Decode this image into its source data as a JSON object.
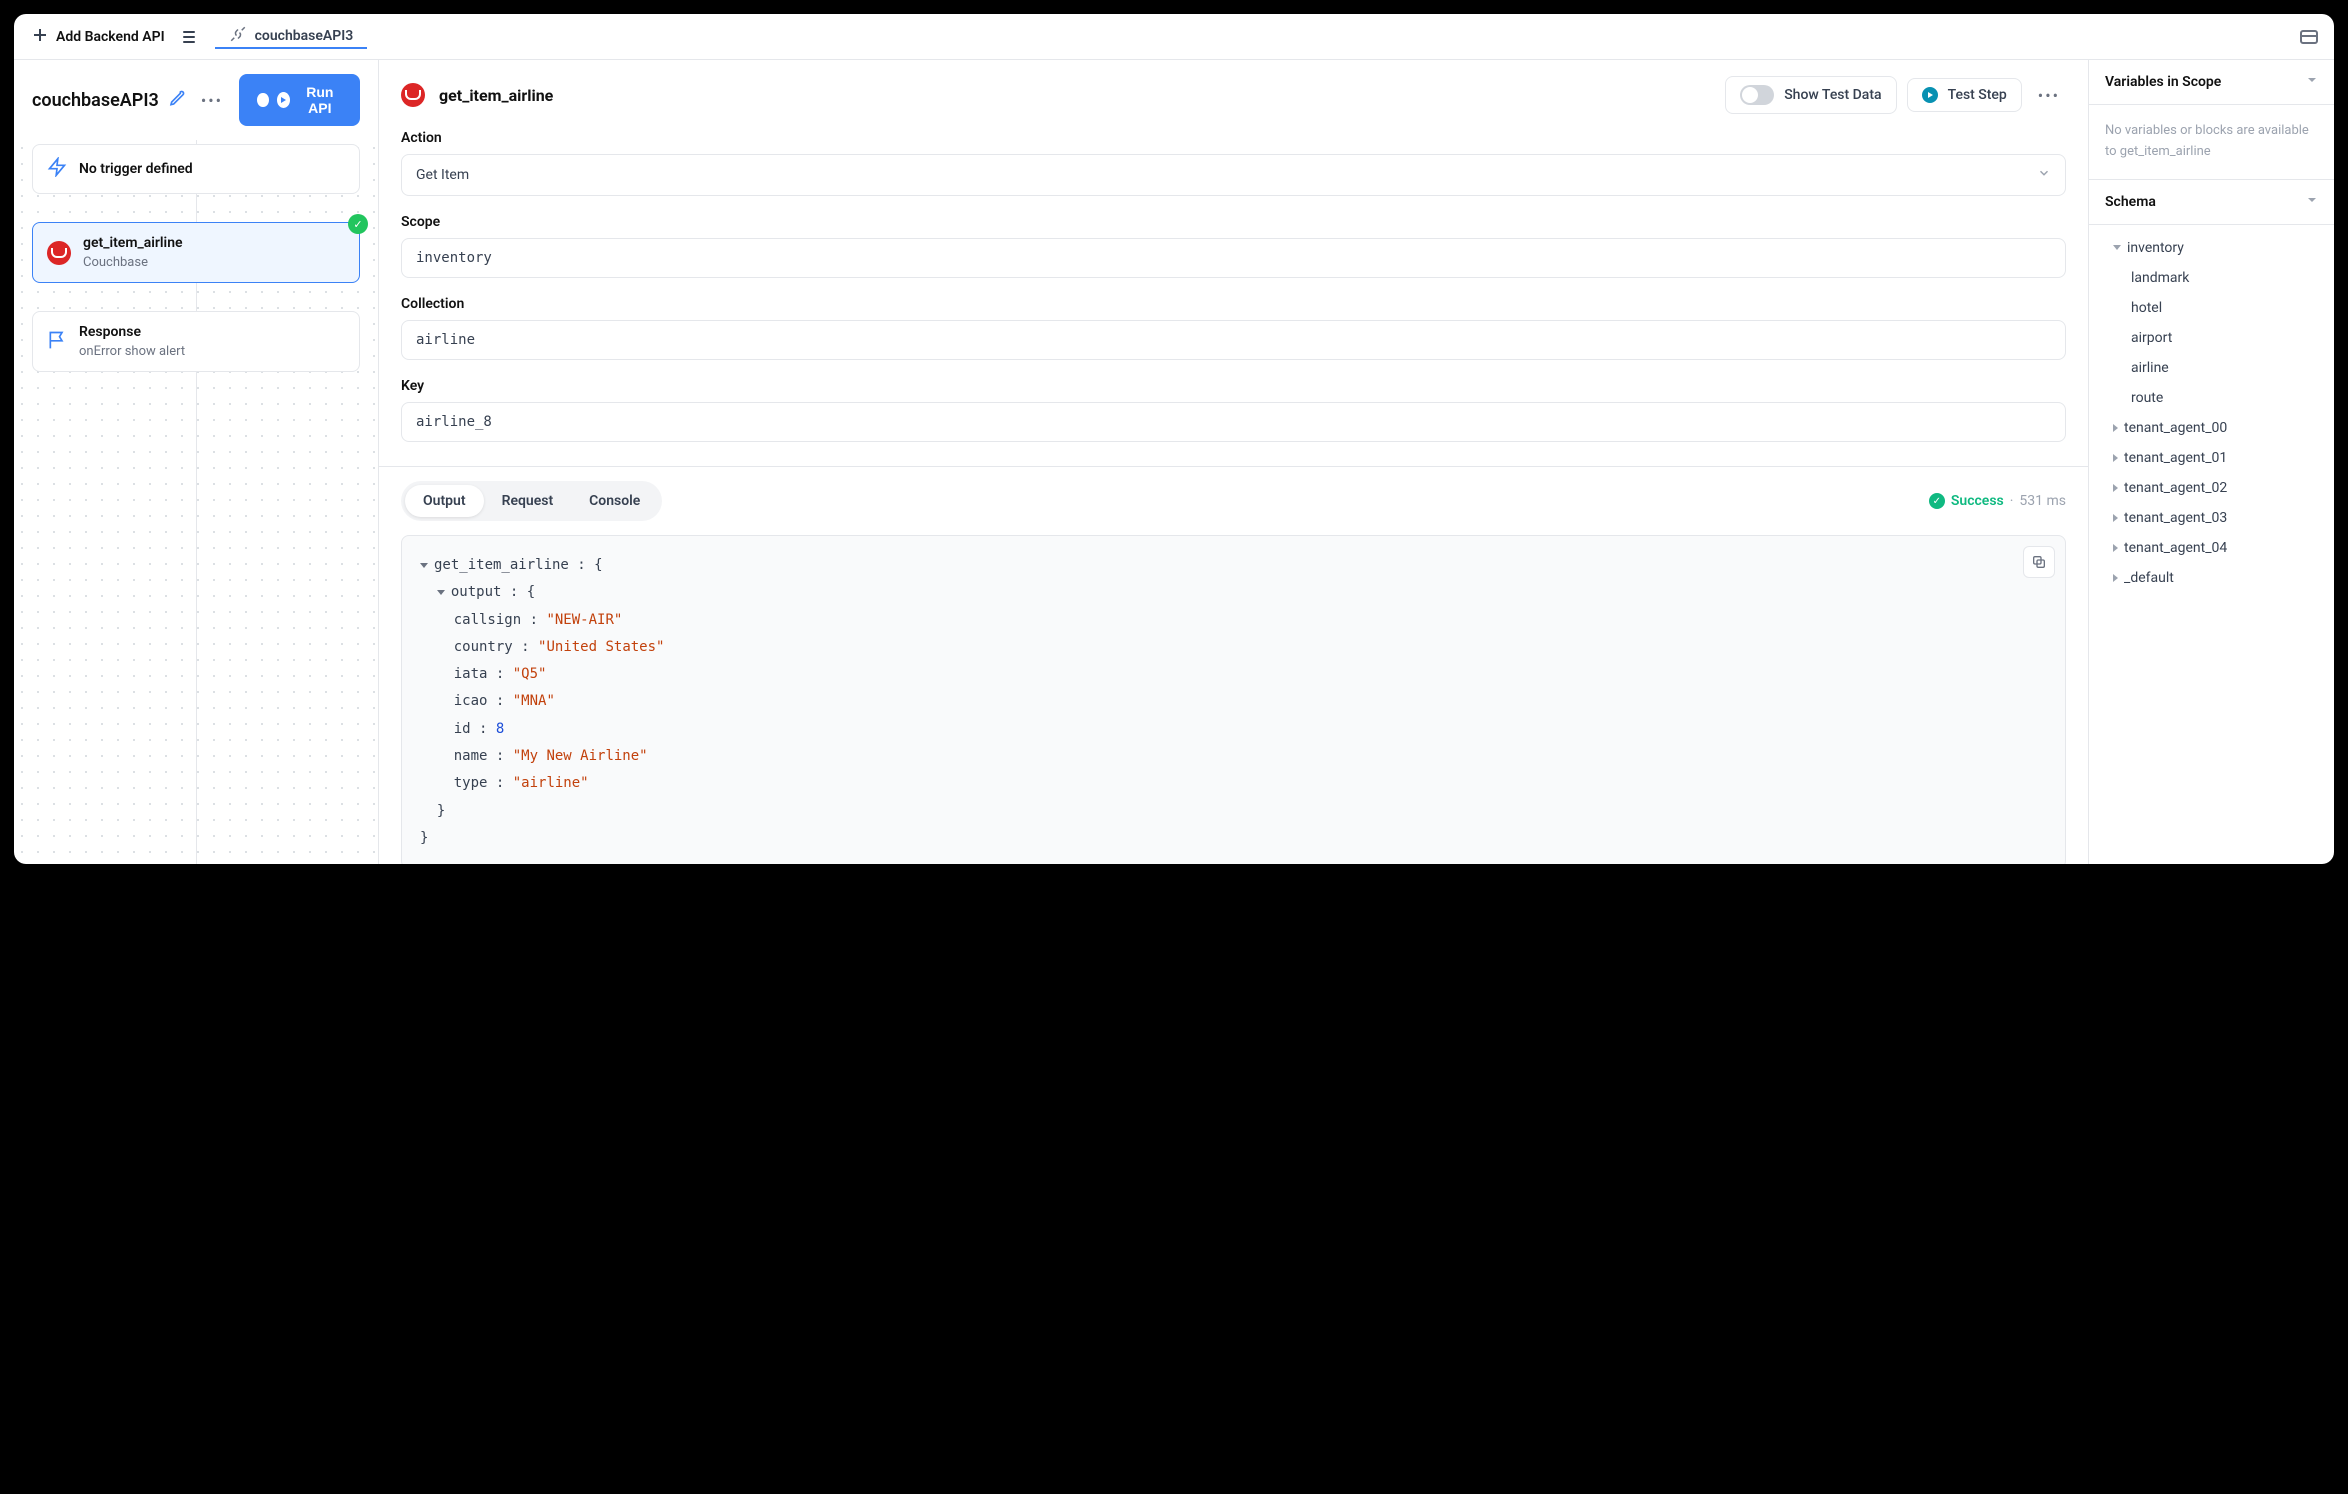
{
  "topbar": {
    "add_backend_label": "Add Backend API",
    "tab_label": "couchbaseAPI3"
  },
  "left": {
    "api_name": "couchbaseAPI3",
    "run_label": "Run API",
    "trigger_card": {
      "title": "No trigger defined"
    },
    "step_card": {
      "title": "get_item_airline",
      "subtitle": "Couchbase"
    },
    "response_card": {
      "title": "Response",
      "subtitle": "onError show alert"
    }
  },
  "center": {
    "title": "get_item_airline",
    "show_test_data": "Show Test Data",
    "test_step": "Test Step",
    "action_label": "Action",
    "action_value": "Get Item",
    "scope_label": "Scope",
    "scope_value": "inventory",
    "collection_label": "Collection",
    "collection_value": "airline",
    "key_label": "Key",
    "key_value": "airline_8",
    "tabs": {
      "output": "Output",
      "request": "Request",
      "console": "Console"
    },
    "status": {
      "label": "Success",
      "time": "531 ms"
    },
    "output": {
      "root_key": "get_item_airline",
      "output_key": "output",
      "fields": {
        "callsign": "\"NEW-AIR\"",
        "country": "\"United States\"",
        "iata": "\"Q5\"",
        "icao": "\"MNA\"",
        "id": "8",
        "name": "\"My New Airline\"",
        "type": "\"airline\""
      }
    }
  },
  "right": {
    "variables_title": "Variables in Scope",
    "variables_empty": "No variables or blocks are available to get_item_airline",
    "schema_title": "Schema",
    "tree": {
      "inventory": "inventory",
      "inventory_children": [
        "landmark",
        "hotel",
        "airport",
        "airline",
        "route"
      ],
      "scopes": [
        "tenant_agent_00",
        "tenant_agent_01",
        "tenant_agent_02",
        "tenant_agent_03",
        "tenant_agent_04",
        "_default"
      ]
    }
  }
}
